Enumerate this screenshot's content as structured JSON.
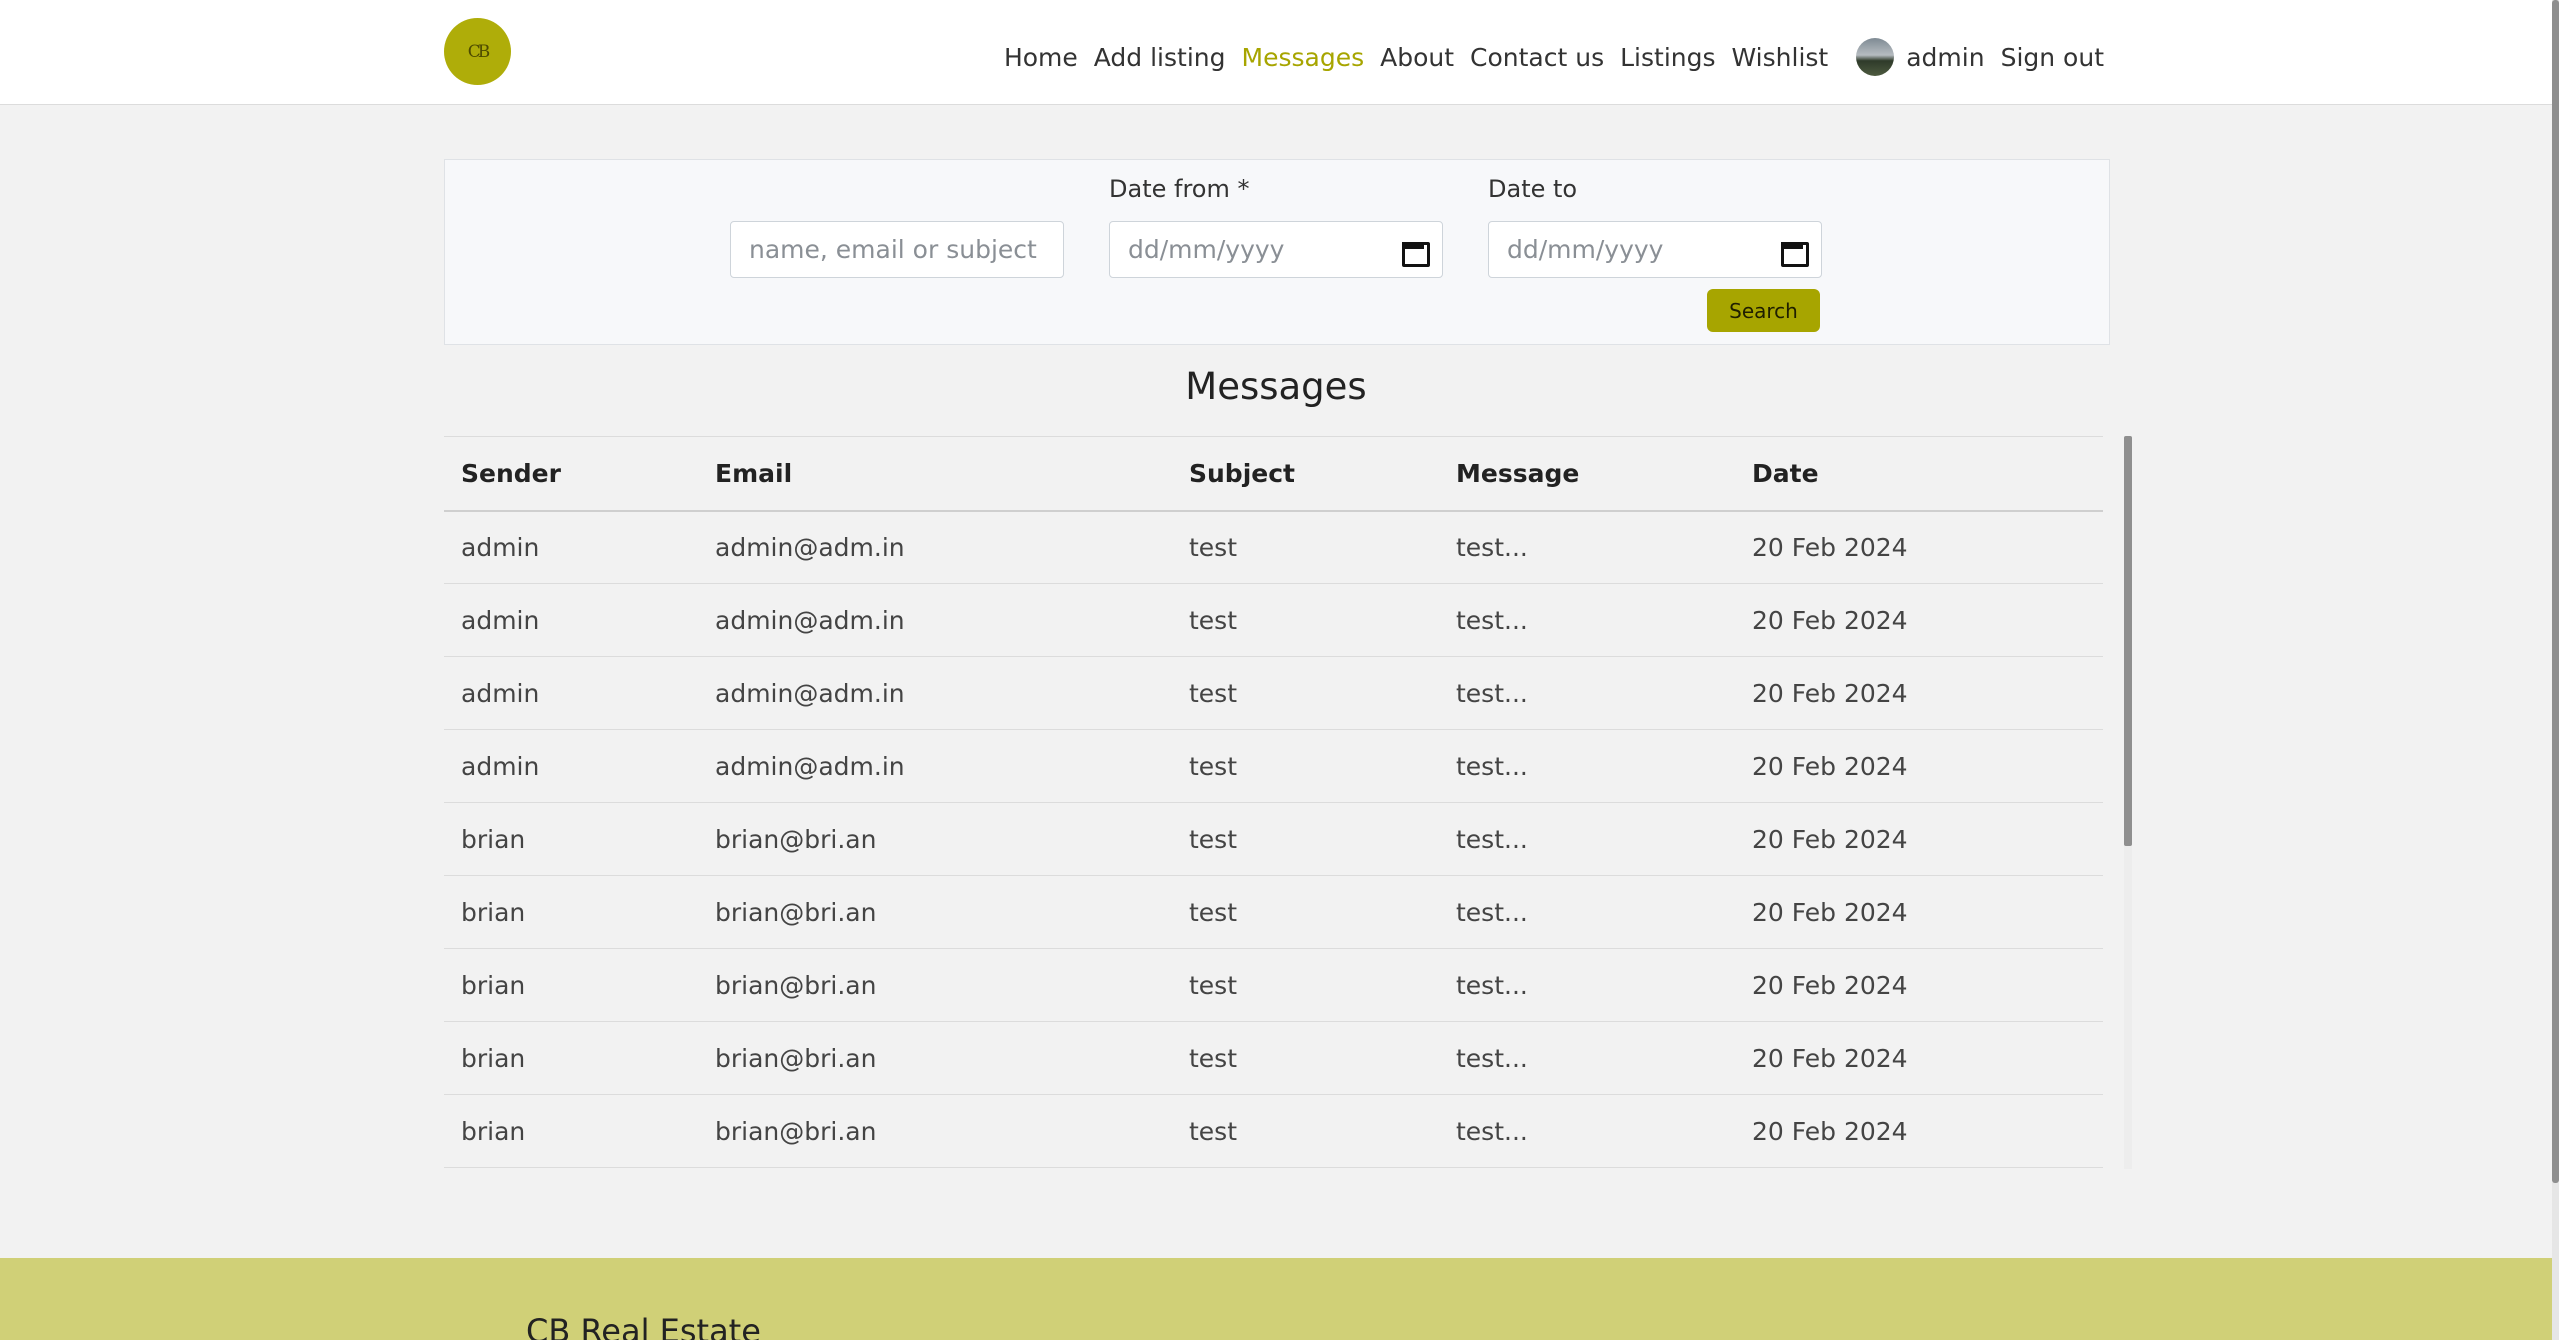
{
  "nav": {
    "logo_text": "CB",
    "links": [
      "Home",
      "Add listing",
      "Messages",
      "About",
      "Contact us",
      "Listings",
      "Wishlist"
    ],
    "active": "Messages",
    "user_name": "admin",
    "sign_out": "Sign out"
  },
  "search": {
    "query_placeholder": "name, email or subject",
    "date_from_label": "Date from *",
    "date_from_placeholder": "dd/mm/yyyy",
    "date_to_label": "Date to",
    "date_to_placeholder": "dd/mm/yyyy",
    "button_label": "Search"
  },
  "title": "Messages",
  "table": {
    "headers": [
      "Sender",
      "Email",
      "Subject",
      "Message",
      "Date"
    ],
    "rows": [
      [
        "admin",
        "admin@adm.in",
        "test",
        "test...",
        "20 Feb 2024"
      ],
      [
        "admin",
        "admin@adm.in",
        "test",
        "test...",
        "20 Feb 2024"
      ],
      [
        "admin",
        "admin@adm.in",
        "test",
        "test...",
        "20 Feb 2024"
      ],
      [
        "admin",
        "admin@adm.in",
        "test",
        "test...",
        "20 Feb 2024"
      ],
      [
        "brian",
        "brian@bri.an",
        "test",
        "test...",
        "20 Feb 2024"
      ],
      [
        "brian",
        "brian@bri.an",
        "test",
        "test...",
        "20 Feb 2024"
      ],
      [
        "brian",
        "brian@bri.an",
        "test",
        "test...",
        "20 Feb 2024"
      ],
      [
        "brian",
        "brian@bri.an",
        "test",
        "test...",
        "20 Feb 2024"
      ],
      [
        "brian",
        "brian@bri.an",
        "test",
        "test...",
        "20 Feb 2024"
      ]
    ]
  },
  "footer": {
    "title": "CB Real Estate"
  },
  "colors": {
    "accent": "#a7a500",
    "footer_bg": "#d0d077"
  },
  "icons": {
    "logo": "logo-icon",
    "avatar": "avatar",
    "calendar": "calendar-icon"
  }
}
